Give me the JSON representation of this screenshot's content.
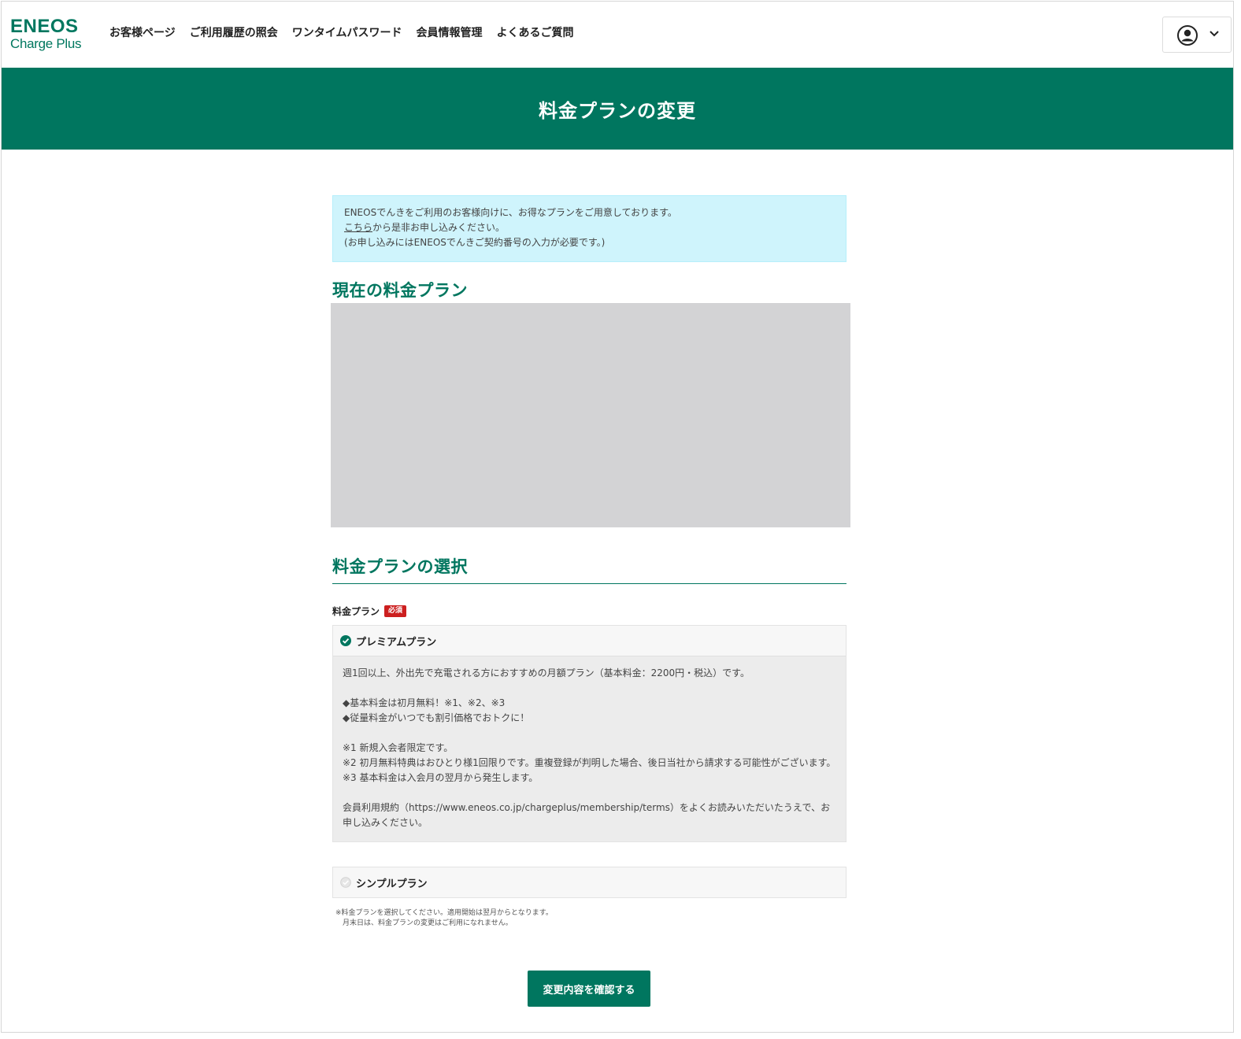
{
  "brand": {
    "logo_top": "ENEOS",
    "logo_bottom": "Charge Plus"
  },
  "nav": {
    "items": [
      {
        "label": "お客様ページ"
      },
      {
        "label": "ご利用履歴の照会"
      },
      {
        "label": "ワンタイムパスワード"
      },
      {
        "label": "会員情報管理"
      },
      {
        "label": "よくあるご質問"
      }
    ]
  },
  "user_menu": {
    "icon": "user-circle-icon",
    "dropdown_icon": "chevron-down-icon"
  },
  "page": {
    "title": "料金プランの変更"
  },
  "notice": {
    "line1": "ENEOSでんきをご利用のお客様向けに、お得なプランをご用意しております。",
    "link_text": "こちら",
    "line2_rest": "から是非お申し込みください。",
    "line3": "(お申し込みにはENEOSでんきご契約番号の入力が必要です。)"
  },
  "current_plan": {
    "heading": "現在の料金プラン"
  },
  "plan_select": {
    "heading": "料金プランの選択",
    "field_label": "料金プラン",
    "required_badge": "必須",
    "options": [
      {
        "name": "プレミアムプラン",
        "selected": true,
        "description": {
          "summary": "週1回以上、外出先で充電される方におすすめの月額プラン（基本料金：2200円・税込）です。",
          "bullet1": "◆基本料金は初月無料！※1、※2、※3",
          "bullet2": "◆従量料金がいつでも割引価格でおトクに！",
          "note1": "※1 新規入会者限定です。",
          "note2": "※2 初月無料特典はおひとり様1回限りです。重複登録が判明した場合、後日当社から請求する可能性がございます。",
          "note3": "※3 基本料金は入会月の翌月から発生します。",
          "terms": "会員利用規約（https://www.eneos.co.jp/chargeplus/membership/terms）をよくお読みいただいたうえで、お申し込みください。"
        }
      },
      {
        "name": "シンプルプラン",
        "selected": false
      }
    ],
    "footnote_line1": "※料金プランを選択してください。適用開始は翌月からとなります。",
    "footnote_line2": "月末日は、料金プランの変更はご利用になれません。"
  },
  "actions": {
    "confirm_label": "変更内容を確認する"
  },
  "colors": {
    "brand_green": "#00765f",
    "notice_bg": "#cff4fc",
    "required_red": "#cc1f1f"
  }
}
